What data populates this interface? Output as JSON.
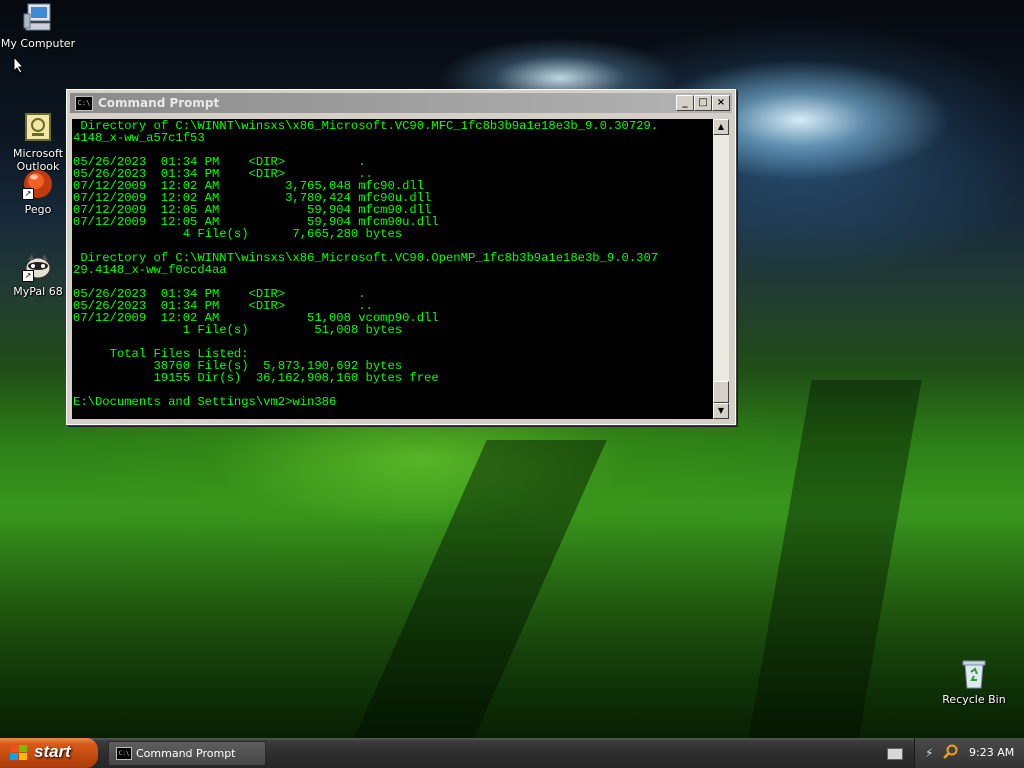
{
  "desktop": {
    "icons": [
      {
        "label": "My Computer"
      },
      {
        "label": "Microsoft\nOutlook"
      },
      {
        "label": "Pego"
      },
      {
        "label": "MyPal 68"
      },
      {
        "label": "Recycle Bin"
      }
    ]
  },
  "window": {
    "title": "Command Prompt",
    "icon_text": "C:\\",
    "buttons": {
      "minimize": "_",
      "maximize": "□",
      "close": "×"
    },
    "console_lines": [
      " Directory of C:\\WINNT\\winsxs\\x86_Microsoft.VC90.MFC_1fc8b3b9a1e18e3b_9.0.30729.",
      "4148_x-ww_a57c1f53",
      "",
      "05/26/2023  01:34 PM    <DIR>          .",
      "05/26/2023  01:34 PM    <DIR>          ..",
      "07/12/2009  12:02 AM         3,765,048 mfc90.dll",
      "07/12/2009  12:02 AM         3,780,424 mfc90u.dll",
      "07/12/2009  12:05 AM            59,904 mfcm90.dll",
      "07/12/2009  12:05 AM            59,904 mfcm90u.dll",
      "               4 File(s)      7,665,280 bytes",
      "",
      " Directory of C:\\WINNT\\winsxs\\x86_Microsoft.VC90.OpenMP_1fc8b3b9a1e18e3b_9.0.307",
      "29.4148_x-ww_f0ccd4aa",
      "",
      "05/26/2023  01:34 PM    <DIR>          .",
      "05/26/2023  01:34 PM    <DIR>          ..",
      "07/12/2009  12:02 AM            51,008 vcomp90.dll",
      "               1 File(s)         51,008 bytes",
      "",
      "     Total Files Listed:",
      "           38760 File(s)  5,873,190,692 bytes",
      "           19155 Dir(s)  36,162,908,160 bytes free",
      "",
      "E:\\Documents and Settings\\vm2>win386"
    ],
    "scrollbar": {
      "up": "▲",
      "down": "▼"
    }
  },
  "taskbar": {
    "start_label": "start",
    "tasks": [
      {
        "label": "Command Prompt",
        "icon_text": "C:\\"
      }
    ],
    "clock": "9:23 AM"
  },
  "colors": {
    "console_text": "#00ff00",
    "console_bg": "#000000",
    "start_orange": "#d85a1a"
  }
}
